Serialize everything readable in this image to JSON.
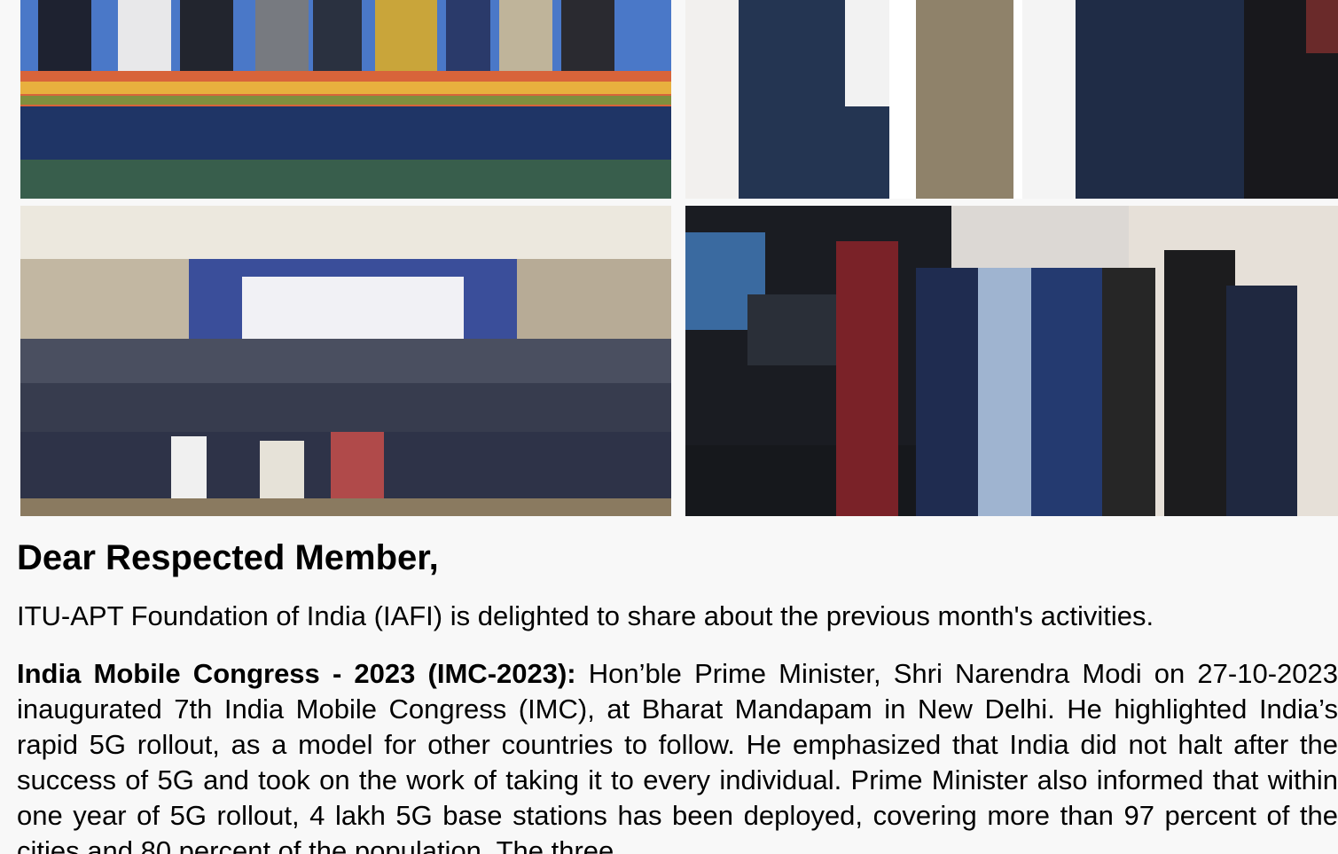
{
  "photos": [
    {
      "description_icon": "photo-conference-dais"
    },
    {
      "description_icon": "photo-group-standing"
    },
    {
      "description_icon": "photo-group-ceremony"
    },
    {
      "description_icon": "photo-booth-group"
    }
  ],
  "greeting": "Dear Respected Member,",
  "intro": "ITU-APT Foundation of India (IAFI) is delighted to share about the previous month's activities.",
  "article": {
    "heading": "India Mobile Congress - 2023 (IMC-2023):",
    "body": " Hon’ble Prime Minister, Shri Narendra Modi on 27-10-2023 inaugurated 7th India Mobile Congress (IMC), at Bharat Mandapam in New Delhi. He highlighted India’s rapid 5G rollout, as a model for other countries to follow. He emphasized that India did not halt after the success of 5G and took on the work of taking it to every individual. Prime Minister also informed that within one year of 5G rollout, 4 lakh 5G base stations has been deployed, covering more than 97 percent of the cities and 80 percent of the population. The three"
  },
  "colors": {
    "page_bg": "#f8f8f8",
    "text": "#000000"
  }
}
